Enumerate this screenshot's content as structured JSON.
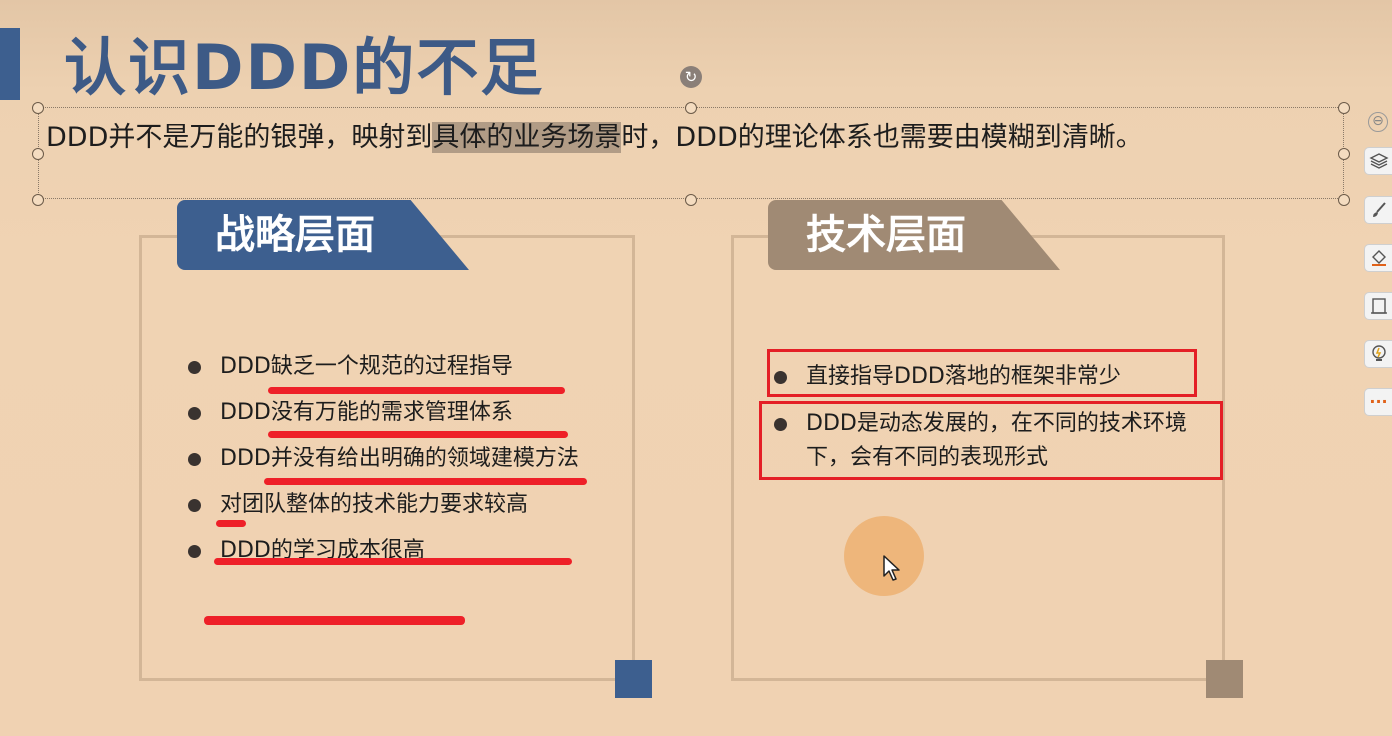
{
  "slide": {
    "title": "认识DDD的不足",
    "subtitle": {
      "before": "DDD并不是万能的银弹，映射到",
      "highlight": "具体的业务场景",
      "after": "时，DDD的理论体系也需要由模糊到清晰。"
    },
    "left_card": {
      "header": "战略层面",
      "items": [
        "DDD缺乏一个规范的过程指导",
        "DDD没有万能的需求管理体系",
        "DDD并没有给出明确的领域建模方法",
        "对团队整体的技术能力要求较高",
        "DDD的学习成本很高"
      ]
    },
    "right_card": {
      "header": "技术层面",
      "items": [
        "直接指导DDD落地的框架非常少",
        "DDD是动态发展的，在不同的技术环境下，会有不同的表现形式"
      ]
    }
  },
  "toolbar": {
    "collapse_icon": "⊖",
    "icons": [
      "layers-icon",
      "brush-icon",
      "fill-icon",
      "frame-icon",
      "lightbulb-icon",
      "more-icon"
    ],
    "more_label": "···"
  },
  "colors": {
    "accent_blue": "#3d5f8f",
    "accent_taupe": "#a08a74",
    "annotation_red": "#ee2028",
    "background": "#f0d2b2"
  }
}
